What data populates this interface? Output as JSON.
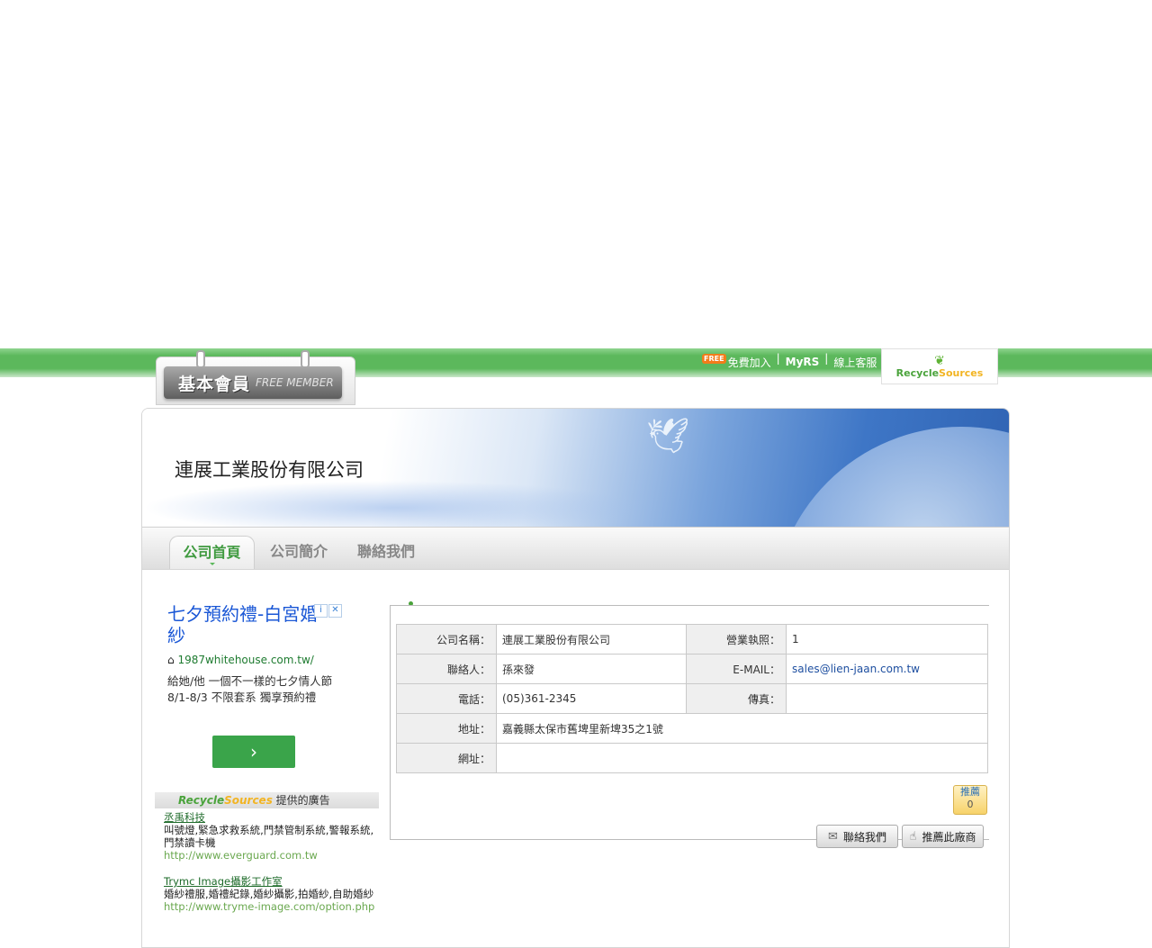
{
  "header": {
    "member_badge_zh": "基本會員",
    "member_badge_en": "FREE MEMBER",
    "free_tag": "FREE",
    "links": [
      "免費加入",
      "MyRS",
      "線上客服"
    ],
    "logo_text_a": "Recycle",
    "logo_text_b": "Sources"
  },
  "company": {
    "title": "連展工業股份有限公司"
  },
  "nav": {
    "tabs": [
      {
        "label": "公司首頁",
        "active": true
      },
      {
        "label": "公司簡介",
        "active": false
      },
      {
        "label": "聯絡我們",
        "active": false
      }
    ]
  },
  "google_ad": {
    "title": "七夕預約禮-白宮婚紗",
    "url": "1987whitehouse.com.tw/",
    "desc": "給她/他 一個不一樣的七夕情人節 8/1-8/3 不限套系 獨享預約禮",
    "arrow": "›"
  },
  "rs_ads": {
    "header_brand_a": "Recycle",
    "header_brand_b": "Sources",
    "header_suffix": "提供的廣告",
    "items": [
      {
        "title": "丞禹科技",
        "desc": "叫號燈,緊急求救系統,門禁管制系統,警報系統,門禁讀卡機",
        "url": "http://www.everguard.com.tw"
      },
      {
        "title": "Trymc Image攝影工作室",
        "desc": "婚紗禮服,婚禮紀錄,婚紗攝影,拍婚紗,自助婚紗",
        "url": "http://www.tryme-image.com/option.php"
      }
    ]
  },
  "info": {
    "company_name_label": "公司名稱：",
    "company_name": "連展工業股份有限公司",
    "license_label": "營業執照：",
    "license": "1",
    "contact_label": "聯絡人：",
    "contact": "孫來發",
    "email_label": "E-MAIL：",
    "email": "sales@lien-jaan.com.tw",
    "phone_label": "電話：",
    "phone": "(05)361-2345",
    "fax_label": "傳真：",
    "fax": "",
    "address_label": "地址：",
    "address": "嘉義縣太保市舊埤里新埤35之1號",
    "website_label": "網址：",
    "website": ""
  },
  "actions": {
    "recommend_label": "推薦",
    "recommend_count": "0",
    "contact_button": "聯絡我們",
    "recommend_button": "推薦此廠商"
  }
}
